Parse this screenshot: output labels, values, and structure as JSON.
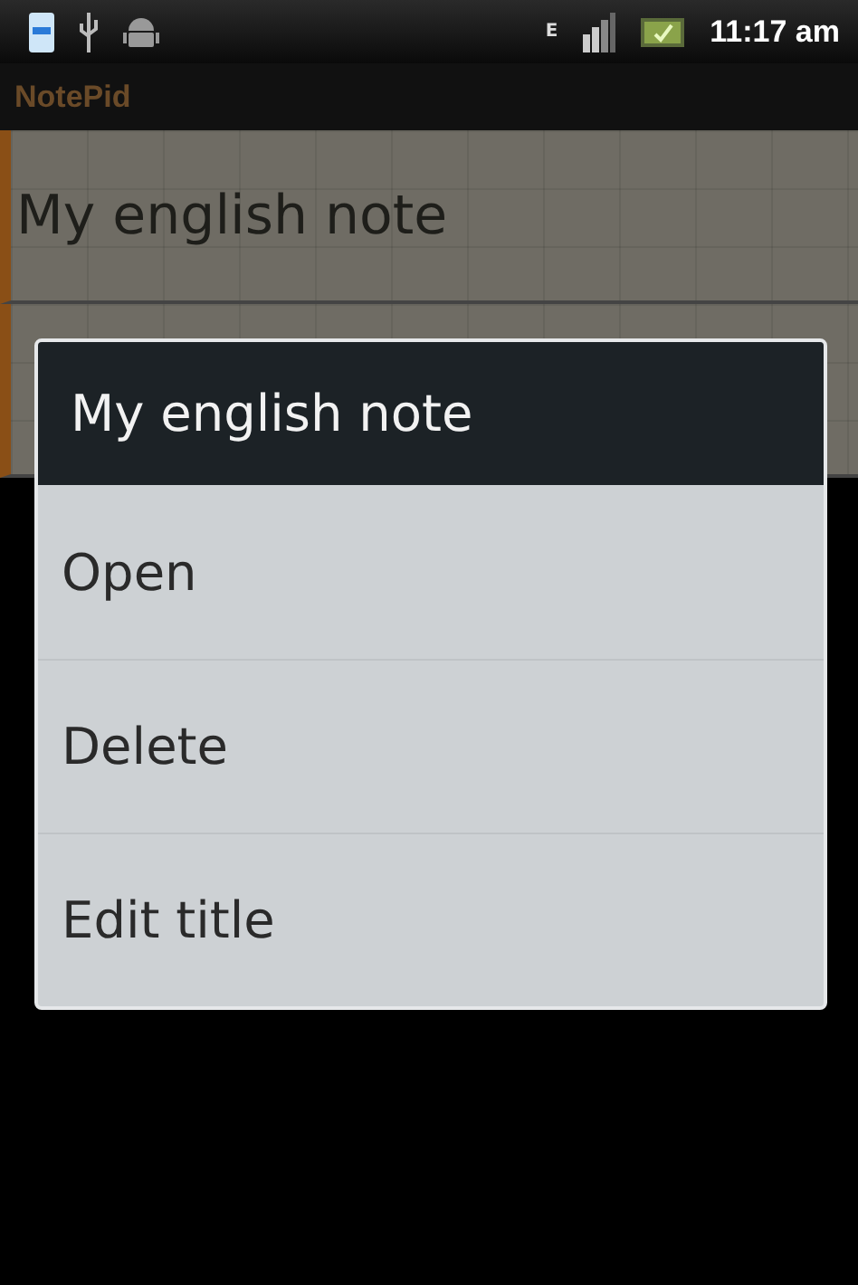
{
  "status_bar": {
    "network": "E",
    "time": "11:17 am"
  },
  "app_bar": {
    "title": "NotePid"
  },
  "notes": [
    {
      "kind": "note",
      "title": "My english note"
    },
    {
      "kind": "covered"
    }
  ],
  "context_menu": {
    "title": "My english note",
    "items": [
      {
        "label": "Open"
      },
      {
        "label": "Delete"
      },
      {
        "label": "Edit title"
      }
    ]
  }
}
